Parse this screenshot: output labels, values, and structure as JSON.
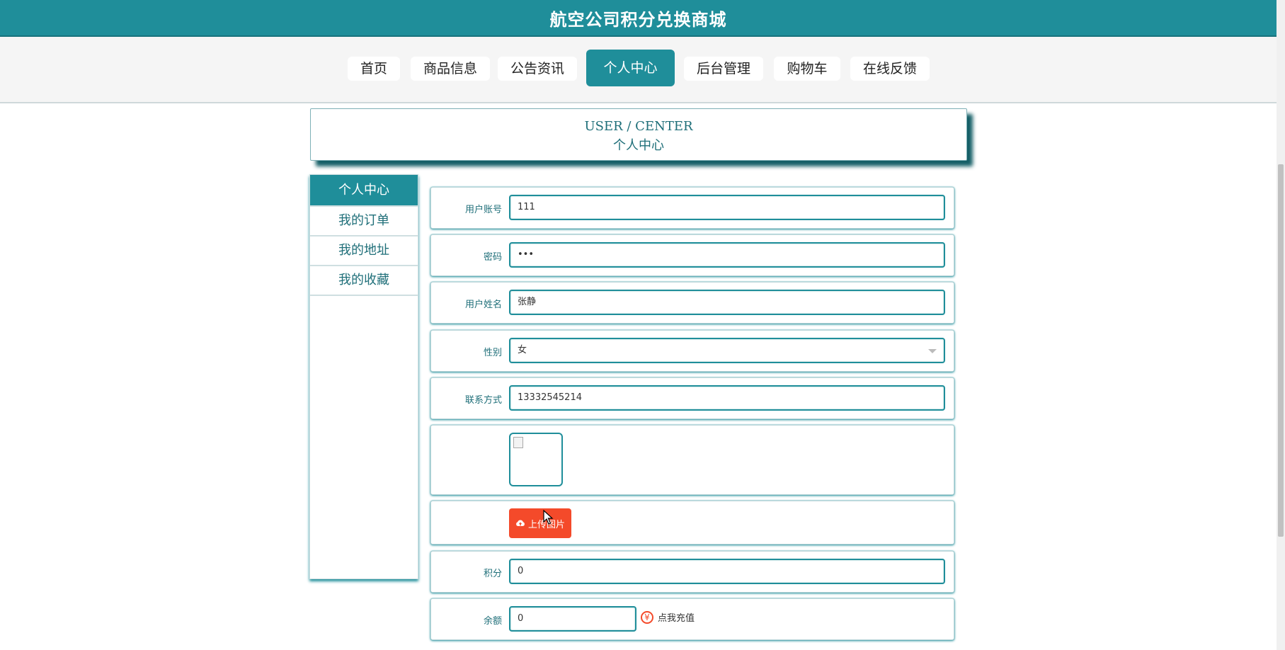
{
  "header": {
    "title": "航空公司积分兑换商城"
  },
  "nav": {
    "items": [
      {
        "label": "首页"
      },
      {
        "label": "商品信息"
      },
      {
        "label": "公告资讯"
      },
      {
        "label": "个人中心"
      },
      {
        "label": "后台管理"
      },
      {
        "label": "购物车"
      },
      {
        "label": "在线反馈"
      }
    ],
    "active": "个人中心"
  },
  "section_header": {
    "en": "USER / CENTER",
    "cn": "个人中心"
  },
  "side_menu": {
    "items": [
      {
        "label": "个人中心"
      },
      {
        "label": "我的订单"
      },
      {
        "label": "我的地址"
      },
      {
        "label": "我的收藏"
      }
    ],
    "active": "个人中心"
  },
  "form": {
    "account": {
      "label": "用户账号",
      "value": "111"
    },
    "password": {
      "label": "密码",
      "value": "•••"
    },
    "name": {
      "label": "用户姓名",
      "value": "张静"
    },
    "gender": {
      "label": "性别",
      "value": "女"
    },
    "phone": {
      "label": "联系方式",
      "value": "13332545214"
    },
    "upload": {
      "label": "上传图片"
    },
    "points": {
      "label": "积分",
      "value": "0"
    },
    "balance": {
      "label": "余额",
      "value": "0",
      "recharge_label": "点我充值"
    }
  },
  "colors": {
    "primary": "#1f8e9a",
    "danger": "#f44a2a"
  },
  "icons": {
    "upload": "cloud-upload-icon",
    "recharge": "yen-icon",
    "select": "chevron-down-icon",
    "avatar": "broken-image-icon",
    "cursor": "mouse-pointer-icon"
  }
}
